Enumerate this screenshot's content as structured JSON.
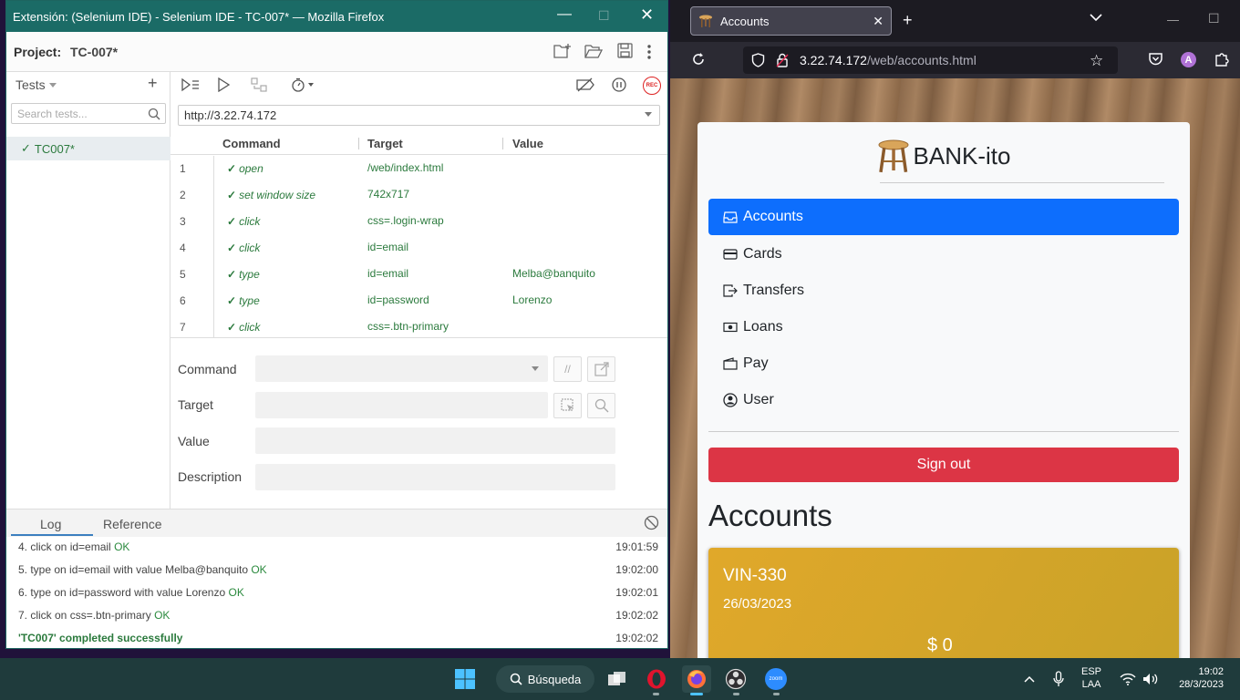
{
  "firefox": {
    "tab_title": "Accounts",
    "url_host": "3.22.74.172",
    "url_path": "/web/accounts.html",
    "profile_initial": "A"
  },
  "bank": {
    "brand": "BANK-ito",
    "nav": [
      "Accounts",
      "Cards",
      "Transfers",
      "Loans",
      "Pay",
      "User"
    ],
    "signout_label": "Sign out",
    "heading": "Accounts",
    "card": {
      "number": "VIN-330",
      "date": "26/03/2023",
      "balance": "$ 0"
    },
    "colors": {
      "primary": "#0d6efd",
      "danger": "#dc3545",
      "card": "#dba62a"
    }
  },
  "ide": {
    "window_title": "Extensión: (Selenium IDE) - Selenium IDE - TC-007* — Mozilla Firefox",
    "project_label": "Project:",
    "project_name": "TC-007*",
    "tests_label": "Tests",
    "search_placeholder": "Search tests...",
    "test_name": "TC007*",
    "base_url": "http://3.22.74.172",
    "columns": {
      "command": "Command",
      "target": "Target",
      "value": "Value"
    },
    "commands": [
      {
        "n": "1",
        "cmd": "open",
        "target": "/web/index.html",
        "value": ""
      },
      {
        "n": "2",
        "cmd": "set window size",
        "target": "742x717",
        "value": ""
      },
      {
        "n": "3",
        "cmd": "click",
        "target": "css=.login-wrap",
        "value": ""
      },
      {
        "n": "4",
        "cmd": "click",
        "target": "id=email",
        "value": ""
      },
      {
        "n": "5",
        "cmd": "type",
        "target": "id=email",
        "value": "Melba@banquito"
      },
      {
        "n": "6",
        "cmd": "type",
        "target": "id=password",
        "value": "Lorenzo"
      },
      {
        "n": "7",
        "cmd": "click",
        "target": "css=.btn-primary",
        "value": ""
      }
    ],
    "editor": {
      "command_label": "Command",
      "target_label": "Target",
      "value_label": "Value",
      "description_label": "Description",
      "comment_glyph": "//"
    },
    "log_tabs": [
      "Log",
      "Reference"
    ],
    "log": [
      {
        "msg": "4.  click on id=email",
        "status": "OK",
        "time": "19:01:59"
      },
      {
        "msg": "5.  type on id=email with value Melba@banquito",
        "status": "OK",
        "time": "19:02:00"
      },
      {
        "msg": "6.  type on id=password with value Lorenzo",
        "status": "OK",
        "time": "19:02:01"
      },
      {
        "msg": "7.  click on css=.btn-primary",
        "status": "OK",
        "time": "19:02:02"
      }
    ],
    "log_done": {
      "msg": "'TC007' completed successfully",
      "time": "19:02:02"
    },
    "rec_label": "REC",
    "accent": "#1b6b66"
  },
  "taskbar": {
    "search_label": "Búsqueda",
    "lang_top": "ESP",
    "lang_bottom": "LAA",
    "time": "19:02",
    "date": "28/3/2023",
    "zoom_label": "zoom"
  }
}
